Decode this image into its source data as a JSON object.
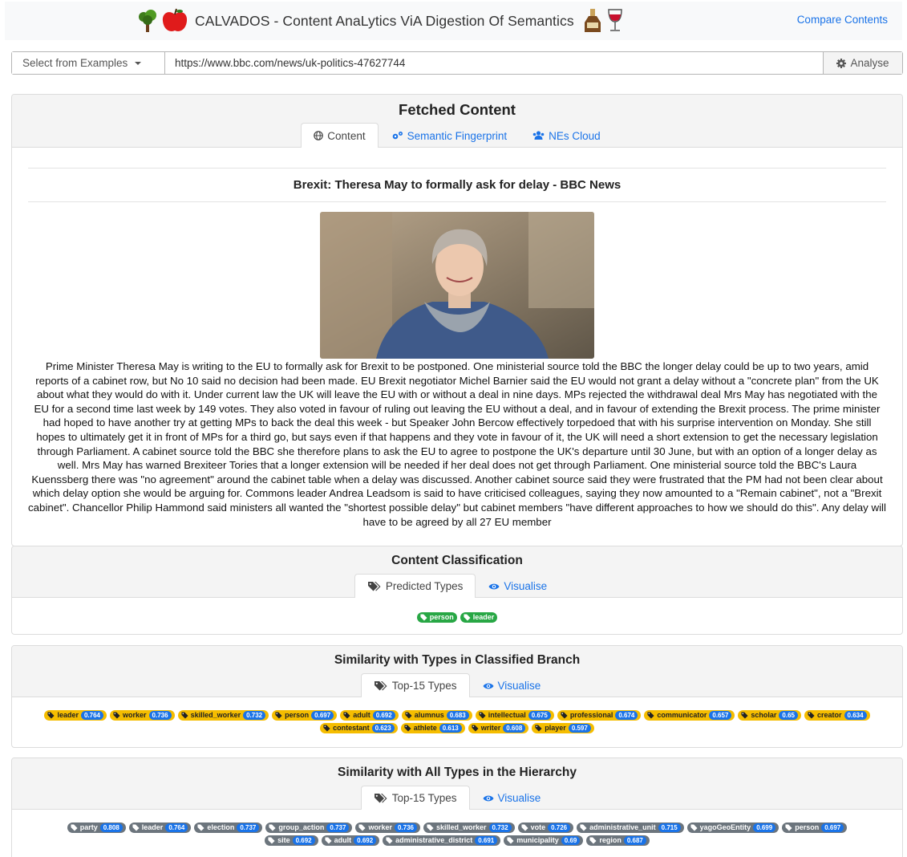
{
  "header": {
    "title": "CALVADOS - Content AnaLytics ViA Digestion Of Semantics",
    "compare_link": "Compare Contents",
    "logo_icons": [
      "tree-icon",
      "apple-icon",
      "bottle-icon",
      "wine-glass-icon"
    ]
  },
  "urlbar": {
    "examples_label": "Select from Examples",
    "url_value": "https://www.bbc.com/news/uk-politics-47627744",
    "analyse_label": "Analyse"
  },
  "fetched": {
    "title": "Fetched Content",
    "tabs": [
      {
        "label": "Content",
        "icon": "globe-icon",
        "active": true
      },
      {
        "label": "Semantic Fingerprint",
        "icon": "cogs-icon",
        "active": false
      },
      {
        "label": "NEs Cloud",
        "icon": "users-icon",
        "active": false
      }
    ],
    "article_title": "Brexit: Theresa May to formally ask for delay - BBC News",
    "article_text": "Prime Minister Theresa May is writing to the EU to formally ask for Brexit to be postponed. One ministerial source told the BBC the longer delay could be up to two years, amid reports of a cabinet row, but No 10 said no decision had been made. EU Brexit negotiator Michel Barnier said the EU would not grant a delay without a \"concrete plan\" from the UK about what they would do with it. Under current law the UK will leave the EU with or without a deal in nine days. MPs rejected the withdrawal deal Mrs May has negotiated with the EU for a second time last week by 149 votes. They also voted in favour of ruling out leaving the EU without a deal, and in favour of extending the Brexit process. The prime minister had hoped to have another try at getting MPs to back the deal this week - but Speaker John Bercow effectively torpedoed that with his surprise intervention on Monday. She still hopes to ultimately get it in front of MPs for a third go, but says even if that happens and they vote in favour of it, the UK will need a short extension to get the necessary legislation through Parliament. A cabinet source told the BBC she therefore plans to ask the EU to agree to postpone the UK's departure until 30 June, but with an option of a longer delay as well. Mrs May has warned Brexiteer Tories that a longer extension will be needed if her deal does not get through Parliament. One ministerial source told the BBC's Laura Kuenssberg there was \"no agreement\" around the cabinet table when a delay was discussed. Another cabinet source said they were frustrated that the PM had not been clear about which delay option she would be arguing for. Commons leader Andrea Leadsom is said to have criticised colleagues, saying they now amounted to a \"Remain cabinet\", not a \"Brexit cabinet\". Chancellor Philip Hammond said ministers all wanted the \"shortest possible delay\" but cabinet members \"have different approaches to how we should do this\". Any delay will have to be agreed by all 27 EU member"
  },
  "classification": {
    "title": "Content Classification",
    "tabs": [
      {
        "label": "Predicted Types",
        "icon": "tags-icon",
        "active": true
      },
      {
        "label": "Visualise",
        "icon": "eye-icon",
        "active": false
      }
    ],
    "tags": [
      {
        "label": "person"
      },
      {
        "label": "leader"
      }
    ],
    "tag_color": "#28a745"
  },
  "similarity_branch": {
    "title": "Similarity with Types in Classified Branch",
    "tabs": [
      {
        "label": "Top-15 Types",
        "icon": "tags-icon",
        "active": true
      },
      {
        "label": "Visualise",
        "icon": "eye-icon",
        "active": false
      }
    ],
    "tag_color": "#f5bd00",
    "tags": [
      {
        "label": "leader",
        "score": "0.764"
      },
      {
        "label": "worker",
        "score": "0.736"
      },
      {
        "label": "skilled_worker",
        "score": "0.732"
      },
      {
        "label": "person",
        "score": "0.697"
      },
      {
        "label": "adult",
        "score": "0.692"
      },
      {
        "label": "alumnus",
        "score": "0.683"
      },
      {
        "label": "intellectual",
        "score": "0.675"
      },
      {
        "label": "professional",
        "score": "0.674"
      },
      {
        "label": "communicator",
        "score": "0.657"
      },
      {
        "label": "scholar",
        "score": "0.65"
      },
      {
        "label": "creator",
        "score": "0.634"
      },
      {
        "label": "contestant",
        "score": "0.623"
      },
      {
        "label": "athlete",
        "score": "0.613"
      },
      {
        "label": "writer",
        "score": "0.608"
      },
      {
        "label": "player",
        "score": "0.597"
      }
    ]
  },
  "similarity_all": {
    "title": "Similarity with All Types in the Hierarchy",
    "tabs": [
      {
        "label": "Top-15 Types",
        "icon": "tags-icon",
        "active": true
      },
      {
        "label": "Visualise",
        "icon": "eye-icon",
        "active": false
      }
    ],
    "tag_color": "#6c757d",
    "tags": [
      {
        "label": "party",
        "score": "0.808"
      },
      {
        "label": "leader",
        "score": "0.764"
      },
      {
        "label": "election",
        "score": "0.737"
      },
      {
        "label": "group_action",
        "score": "0.737"
      },
      {
        "label": "worker",
        "score": "0.736"
      },
      {
        "label": "skilled_worker",
        "score": "0.732"
      },
      {
        "label": "vote",
        "score": "0.726"
      },
      {
        "label": "administrative_unit",
        "score": "0.715"
      },
      {
        "label": "yagoGeoEntity",
        "score": "0.699"
      },
      {
        "label": "person",
        "score": "0.697"
      },
      {
        "label": "site",
        "score": "0.692"
      },
      {
        "label": "adult",
        "score": "0.692"
      },
      {
        "label": "administrative_district",
        "score": "0.691"
      },
      {
        "label": "municipality",
        "score": "0.69"
      },
      {
        "label": "region",
        "score": "0.687"
      }
    ]
  }
}
